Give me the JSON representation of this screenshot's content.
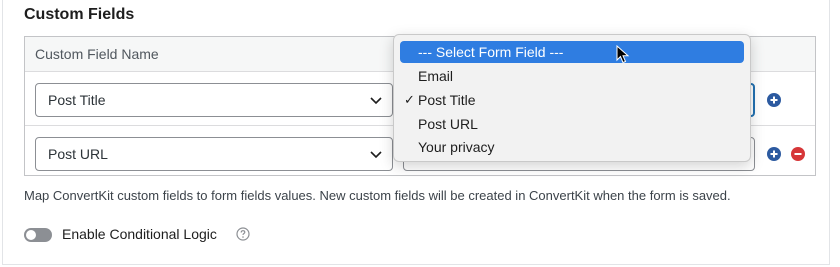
{
  "section": {
    "title": "Custom Fields"
  },
  "table": {
    "column_header": "Custom Field Name",
    "rows": [
      {
        "field_name": "Post Title"
      },
      {
        "field_name": "Post URL"
      }
    ]
  },
  "help_text": "Map ConvertKit custom fields to form fields values. New custom fields will be created in ConvertKit when the form is saved.",
  "conditional_logic": {
    "label": "Enable Conditional Logic",
    "enabled": false
  },
  "dropdown": {
    "options": [
      {
        "label": "--- Select Form Field ---",
        "highlighted": true,
        "checked": false
      },
      {
        "label": "Email",
        "highlighted": false,
        "checked": false
      },
      {
        "label": "Post Title",
        "highlighted": false,
        "checked": true
      },
      {
        "label": "Post URL",
        "highlighted": false,
        "checked": false
      },
      {
        "label": "Your privacy",
        "highlighted": false,
        "checked": false
      }
    ],
    "check_glyph": "✓"
  },
  "colors": {
    "add_icon": "#2c5aa0",
    "remove_icon": "#d63638",
    "highlight": "#2f7de1"
  },
  "icons": [
    "chevron-down-icon",
    "add-circle-icon",
    "remove-circle-icon",
    "help-circle-icon",
    "mouse-cursor-icon"
  ]
}
